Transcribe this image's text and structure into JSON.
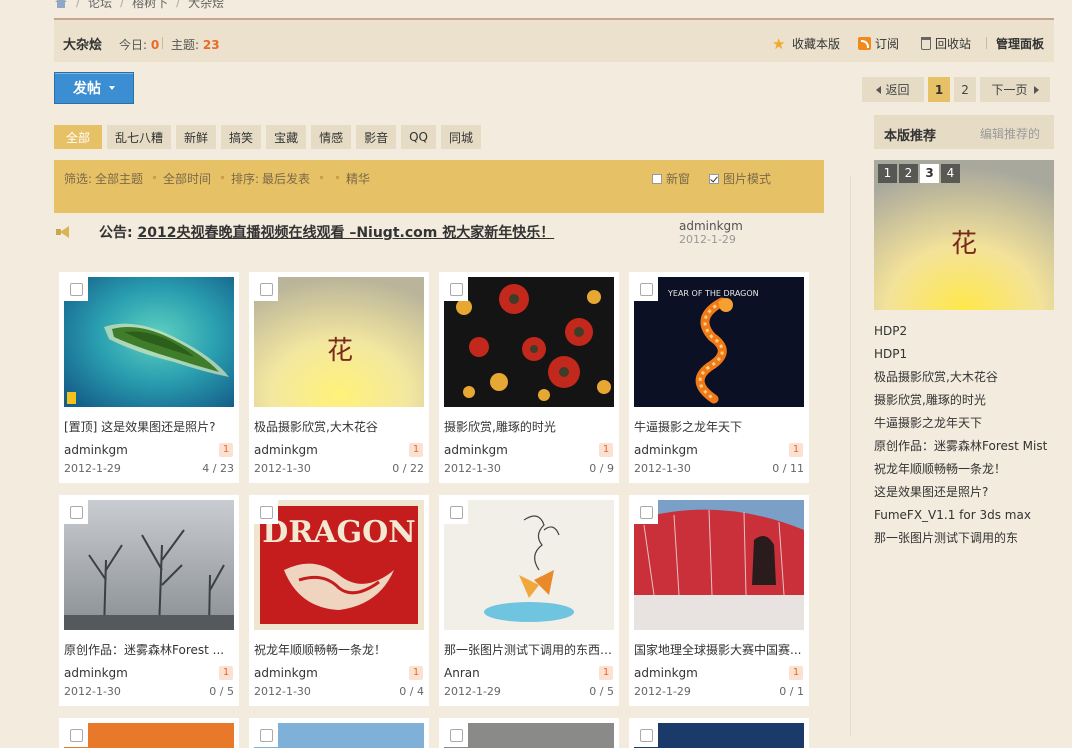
{
  "breadcrumb": {
    "items": [
      "论坛",
      "榕树下",
      "大杂烩"
    ]
  },
  "forum": {
    "name": "大杂烩",
    "today_label": "今日:",
    "today_value": "0",
    "topics_label": "主题:",
    "topics_value": "23",
    "toolbar": {
      "favorite": "收藏本版",
      "subscribe": "订阅",
      "recycle": "回收站",
      "admin": "管理面板"
    }
  },
  "post_button": {
    "label": "发帖"
  },
  "pager": {
    "prev": "返回",
    "pages": [
      "1",
      "2"
    ],
    "current": "1",
    "next": "下一页"
  },
  "categories": [
    "全部",
    "乱七八糟",
    "新鲜",
    "搞笑",
    "宝藏",
    "情感",
    "影音",
    "QQ",
    "同城"
  ],
  "filter": {
    "filter_label": "筛选:",
    "all_topics": "全部主题",
    "all_time": "全部时间",
    "sort_label": "排序:",
    "sort_value": "最后发表",
    "digest": "精华",
    "new_window": "新窗",
    "image_mode": "图片模式"
  },
  "announcement": {
    "label": "公告:",
    "text": "2012央视春晚直播视频在线观看 –Niugt.com 祝大家新年快乐！",
    "author": "adminkgm",
    "date": "2012-1-29"
  },
  "cards": [
    {
      "title": "[置顶] 这是效果图还是照片?",
      "author": "adminkgm",
      "badge": "1",
      "date": "2012-1-29",
      "counts": "4 / 23"
    },
    {
      "title": "极品摄影欣赏,大木花谷",
      "author": "adminkgm",
      "badge": "1",
      "date": "2012-1-30",
      "counts": "0 / 22"
    },
    {
      "title": "摄影欣赏,雕琢的时光",
      "author": "adminkgm",
      "badge": "1",
      "date": "2012-1-30",
      "counts": "0 / 9"
    },
    {
      "title": "牛逼摄影之龙年天下",
      "author": "adminkgm",
      "badge": "1",
      "date": "2012-1-30",
      "counts": "0 / 11"
    },
    {
      "title": "原创作品：迷雾森林Forest ...",
      "author": "adminkgm",
      "badge": "1",
      "date": "2012-1-30",
      "counts": "0 / 5"
    },
    {
      "title": "祝龙年顺顺畅畅一条龙！",
      "author": "adminkgm",
      "badge": "1",
      "date": "2012-1-30",
      "counts": "0 / 4"
    },
    {
      "title": "那一张图片测试下调用的东西....",
      "author": "Anran",
      "badge": "1",
      "date": "2012-1-29",
      "counts": "0 / 5"
    },
    {
      "title": "国家地理全球摄影大赛中国赛...",
      "author": "adminkgm",
      "badge": "1",
      "date": "2012-1-29",
      "counts": "0 / 1"
    }
  ],
  "image_text": {
    "dragon_year": "YEAR OF THE DRAGON",
    "dragon_word": "DRAGON",
    "flower_char": "花"
  },
  "sidebar": {
    "heading": "本版推荐",
    "edit": "编辑推荐的",
    "slides": [
      "1",
      "2",
      "3",
      "4"
    ],
    "active_slide": "3",
    "items": [
      "HDP2",
      "HDP1",
      "极品摄影欣赏,大木花谷",
      "摄影欣赏,雕琢的时光",
      "牛逼摄影之龙年天下",
      "原创作品：迷雾森林Forest Mist",
      "祝龙年顺顺畅畅一条龙！",
      "这是效果图还是照片?",
      "FumeFX_V1.1 for 3ds max",
      "那一张图片测试下调用的东"
    ]
  },
  "colors": {
    "accent": "#e7c165",
    "post_button": "#3a8ed1",
    "badge_text": "#e8672a"
  }
}
